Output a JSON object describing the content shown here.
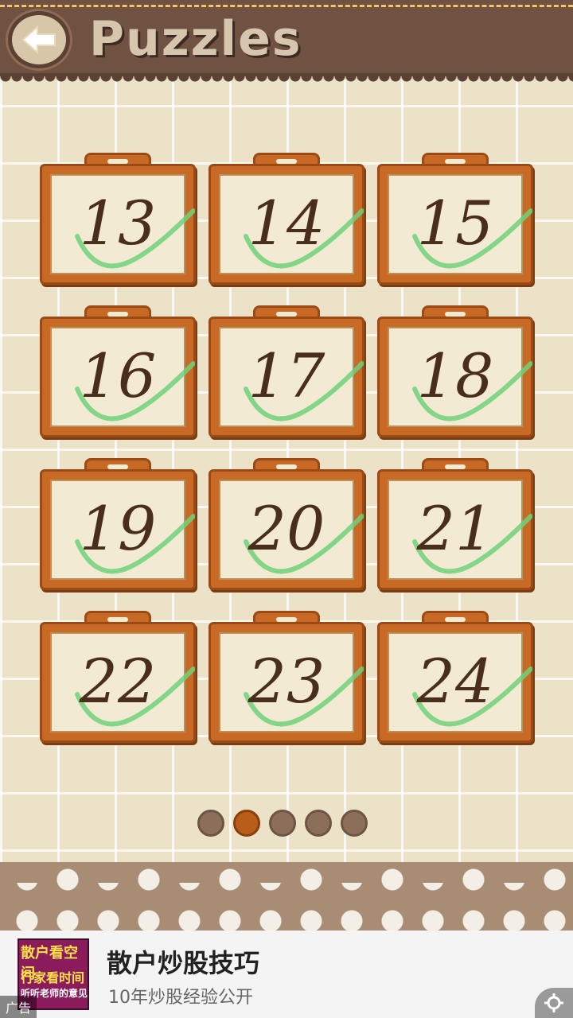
{
  "header": {
    "title": "Puzzles",
    "back_icon": "back-arrow-icon"
  },
  "puzzles": [
    {
      "number": "13",
      "solved": true
    },
    {
      "number": "14",
      "solved": true
    },
    {
      "number": "15",
      "solved": true
    },
    {
      "number": "16",
      "solved": true
    },
    {
      "number": "17",
      "solved": true
    },
    {
      "number": "18",
      "solved": true
    },
    {
      "number": "19",
      "solved": true
    },
    {
      "number": "20",
      "solved": true
    },
    {
      "number": "21",
      "solved": true
    },
    {
      "number": "22",
      "solved": true
    },
    {
      "number": "23",
      "solved": true
    },
    {
      "number": "24",
      "solved": true
    }
  ],
  "pagination": {
    "total_pages": 5,
    "current_page": 2
  },
  "ad": {
    "thumb_line1": "散户看空间",
    "thumb_line2": "行家看时间",
    "thumb_line3": "听听老师的意见",
    "headline": "散户炒股技巧",
    "subline": "10年炒股经验公开",
    "tag": "广告",
    "settings_icon": "ad-settings-icon"
  },
  "colors": {
    "header_bg": "#6f5242",
    "card_frame": "#c86a26",
    "checkmark": "#6fd17a",
    "active_dot": "#b85d1a"
  }
}
